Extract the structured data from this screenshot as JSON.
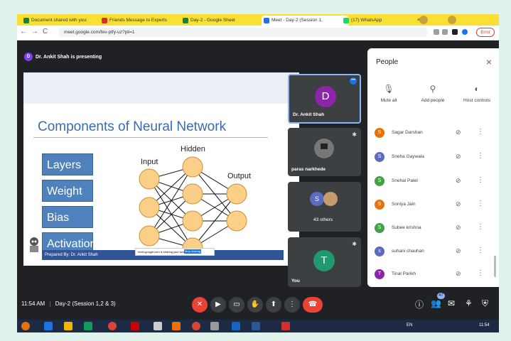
{
  "browser": {
    "tabs": [
      {
        "label": "Document shared with you:",
        "color": "#188038",
        "active": false
      },
      {
        "label": "Friends Message to Experts",
        "color": "#d93025",
        "active": false
      },
      {
        "label": "Day-2 - Google Sheet",
        "color": "#188038",
        "active": false
      },
      {
        "label": "Meet - Day-2 (Session 1,",
        "color": "#1a73e8",
        "active": true
      },
      {
        "label": "(17) WhatsApp",
        "color": "#25d366",
        "active": false
      }
    ],
    "url": "meet.google.com/fev-ptfy-uz?pli=1",
    "error_label": "Error"
  },
  "meeting": {
    "presenter_banner": "Dr. Ankit Shah is presenting",
    "presenter_initial": "D",
    "time": "11:54 AM",
    "separator": "|",
    "title": "Day-2 (Session 1,2 & 3)"
  },
  "slide": {
    "title": "Components of Neural Network",
    "boxes": [
      "Layers",
      "Weight",
      "Bias",
      "Activation"
    ],
    "input_label": "Input",
    "hidden_label": "Hidden",
    "output_label": "Output",
    "footer": "Prepared By: Dr. Ankit Shah",
    "mini_button": "Stop sharing",
    "mini_text": "meet.google.com is sharing your screen."
  },
  "tiles": {
    "presenter": {
      "name": "Dr. Ankit Shah",
      "initial": "D",
      "color": "#8e24aa"
    },
    "paras": {
      "name": "paras narkhede"
    },
    "others": {
      "initial": "S",
      "label": "43 others",
      "color": "#5c6bc0"
    },
    "you": {
      "name": "You",
      "initial": "T",
      "color": "#1e9a6e"
    }
  },
  "people": {
    "title": "People",
    "actions": [
      "Mute all",
      "Add people",
      "Host controls"
    ],
    "participants": [
      {
        "initial": "S",
        "name": "Sagar Darshan",
        "color": "#e8710a"
      },
      {
        "initial": "S",
        "name": "Sneha Gaywala",
        "color": "#5c6bc0"
      },
      {
        "initial": "S",
        "name": "Snehal Patel",
        "color": "#43a047"
      },
      {
        "initial": "S",
        "name": "Soniya Jain",
        "color": "#e8710a"
      },
      {
        "initial": "S",
        "name": "Subee krishna",
        "color": "#43a047"
      },
      {
        "initial": "s",
        "name": "suhani chauhan",
        "color": "#5c6bc0"
      },
      {
        "initial": "T",
        "name": "Tinal Parikh",
        "color": "#8e24aa"
      }
    ]
  },
  "controls": {
    "people_count": "47"
  },
  "taskbar": {
    "lang": "EN",
    "clock": "11:54"
  }
}
